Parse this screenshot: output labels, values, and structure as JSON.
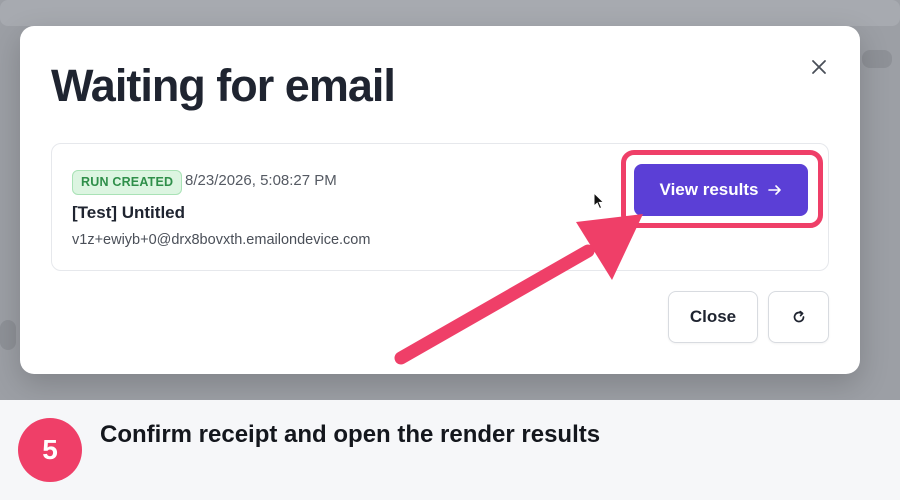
{
  "modal": {
    "title": "Waiting for email",
    "close_icon": "close-icon"
  },
  "run": {
    "status_badge": "RUN CREATED",
    "timestamp": "8/23/2026, 5:08:27 PM",
    "name": "[Test] Untitled",
    "email": "v1z+ewiyb+0@drx8bovxth.emailondevice.com",
    "view_results_label": "View results",
    "view_results_icon": "arrow-right-icon"
  },
  "footer": {
    "close_label": "Close",
    "refresh_icon": "refresh-icon"
  },
  "caption": {
    "step_number": "5",
    "text": "Confirm receipt and open the render results"
  },
  "colors": {
    "accent": "#5b3fd6",
    "highlight": "#ef3f68",
    "badge_bg": "#dcf5e1",
    "badge_text": "#2f8f4a"
  }
}
